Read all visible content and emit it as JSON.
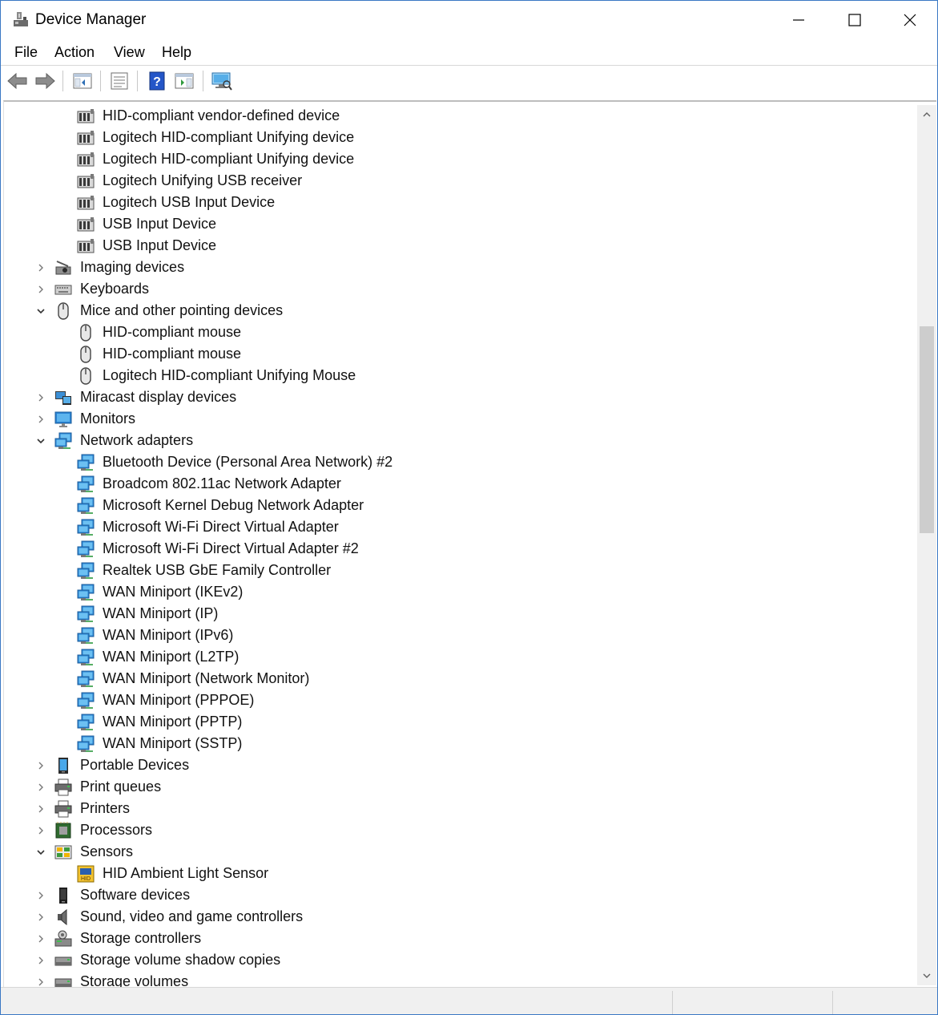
{
  "window": {
    "title": "Device Manager"
  },
  "menu": [
    "File",
    "Action",
    "View",
    "Help"
  ],
  "toolbar": [
    "back-icon",
    "forward-icon",
    "show-hide-tree-icon",
    "properties-icon",
    "help-icon",
    "action-pane-icon",
    "scan-hardware-icon"
  ],
  "tree": [
    {
      "level": 2,
      "icon": "hid",
      "label": "HID-compliant vendor-defined device"
    },
    {
      "level": 2,
      "icon": "hid",
      "label": "Logitech HID-compliant Unifying device"
    },
    {
      "level": 2,
      "icon": "hid",
      "label": "Logitech HID-compliant Unifying device"
    },
    {
      "level": 2,
      "icon": "hid",
      "label": "Logitech Unifying USB receiver"
    },
    {
      "level": 2,
      "icon": "hid",
      "label": "Logitech USB Input Device"
    },
    {
      "level": 2,
      "icon": "hid",
      "label": "USB Input Device"
    },
    {
      "level": 2,
      "icon": "hid",
      "label": "USB Input Device"
    },
    {
      "level": 1,
      "state": "collapsed",
      "icon": "imaging",
      "label": "Imaging devices"
    },
    {
      "level": 1,
      "state": "collapsed",
      "icon": "keyboard",
      "label": "Keyboards"
    },
    {
      "level": 1,
      "state": "expanded",
      "icon": "mouse",
      "label": "Mice and other pointing devices"
    },
    {
      "level": 2,
      "icon": "mouse",
      "label": "HID-compliant mouse"
    },
    {
      "level": 2,
      "icon": "mouse",
      "label": "HID-compliant mouse"
    },
    {
      "level": 2,
      "icon": "mouse",
      "label": "Logitech HID-compliant Unifying Mouse"
    },
    {
      "level": 1,
      "state": "collapsed",
      "icon": "miracast",
      "label": "Miracast display devices"
    },
    {
      "level": 1,
      "state": "collapsed",
      "icon": "monitor",
      "label": "Monitors"
    },
    {
      "level": 1,
      "state": "expanded",
      "icon": "network",
      "label": "Network adapters"
    },
    {
      "level": 2,
      "icon": "network",
      "label": "Bluetooth Device (Personal Area Network) #2"
    },
    {
      "level": 2,
      "icon": "network",
      "label": "Broadcom 802.11ac Network Adapter"
    },
    {
      "level": 2,
      "icon": "network",
      "label": "Microsoft Kernel Debug Network Adapter"
    },
    {
      "level": 2,
      "icon": "network",
      "label": "Microsoft Wi-Fi Direct Virtual Adapter"
    },
    {
      "level": 2,
      "icon": "network",
      "label": "Microsoft Wi-Fi Direct Virtual Adapter #2"
    },
    {
      "level": 2,
      "icon": "network",
      "label": "Realtek USB GbE Family Controller"
    },
    {
      "level": 2,
      "icon": "network",
      "label": "WAN Miniport (IKEv2)"
    },
    {
      "level": 2,
      "icon": "network",
      "label": "WAN Miniport (IP)"
    },
    {
      "level": 2,
      "icon": "network",
      "label": "WAN Miniport (IPv6)"
    },
    {
      "level": 2,
      "icon": "network",
      "label": "WAN Miniport (L2TP)"
    },
    {
      "level": 2,
      "icon": "network",
      "label": "WAN Miniport (Network Monitor)"
    },
    {
      "level": 2,
      "icon": "network",
      "label": "WAN Miniport (PPPOE)"
    },
    {
      "level": 2,
      "icon": "network",
      "label": "WAN Miniport (PPTP)"
    },
    {
      "level": 2,
      "icon": "network",
      "label": "WAN Miniport (SSTP)"
    },
    {
      "level": 1,
      "state": "collapsed",
      "icon": "portable",
      "label": "Portable Devices"
    },
    {
      "level": 1,
      "state": "collapsed",
      "icon": "printer",
      "label": "Print queues"
    },
    {
      "level": 1,
      "state": "collapsed",
      "icon": "printer",
      "label": "Printers"
    },
    {
      "level": 1,
      "state": "collapsed",
      "icon": "processor",
      "label": "Processors"
    },
    {
      "level": 1,
      "state": "expanded",
      "icon": "sensors",
      "label": "Sensors"
    },
    {
      "level": 2,
      "icon": "lightsensor",
      "label": "HID Ambient Light Sensor"
    },
    {
      "level": 1,
      "state": "collapsed",
      "icon": "software",
      "label": "Software devices"
    },
    {
      "level": 1,
      "state": "collapsed",
      "icon": "sound",
      "label": "Sound, video and game controllers"
    },
    {
      "level": 1,
      "state": "collapsed",
      "icon": "storage",
      "label": "Storage controllers"
    },
    {
      "level": 1,
      "state": "collapsed",
      "icon": "drive",
      "label": "Storage volume shadow copies"
    },
    {
      "level": 1,
      "state": "collapsed",
      "icon": "drive",
      "label": "Storage volumes"
    }
  ]
}
